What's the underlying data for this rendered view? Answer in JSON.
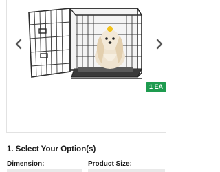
{
  "gallery": {
    "prev_icon": "chevron-left-icon",
    "next_icon": "chevron-right-icon",
    "image_alt": "black wire dog crate with dog inside",
    "badge": "1 EA",
    "badge_color": "#1e9b4f"
  },
  "options": {
    "section_title": "1. Select Your Option(s)",
    "dimension_label": "Dimension:",
    "product_size_label": "Product Size:"
  }
}
